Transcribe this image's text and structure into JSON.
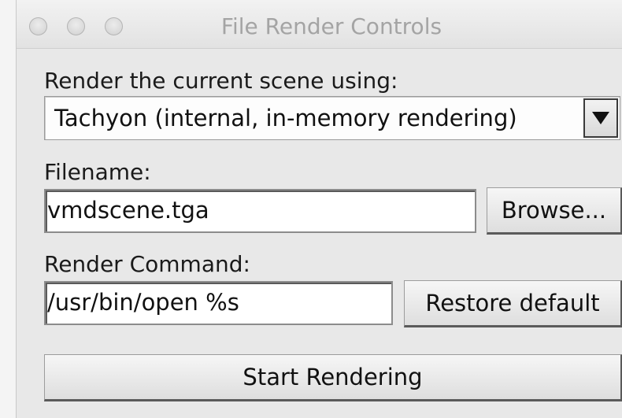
{
  "window": {
    "title": "File Render Controls",
    "controls": [
      "close-icon",
      "minimize-icon",
      "zoom-icon"
    ]
  },
  "render_method": {
    "label": "Render the current scene using:",
    "selected": "Tachyon (internal, in-memory rendering)"
  },
  "filename": {
    "label": "Filename:",
    "value": "vmdscene.tga",
    "browse_label": "Browse..."
  },
  "render_command": {
    "label": "Render Command:",
    "value": "/usr/bin/open %s",
    "restore_label": "Restore default"
  },
  "start_label": "Start Rendering"
}
